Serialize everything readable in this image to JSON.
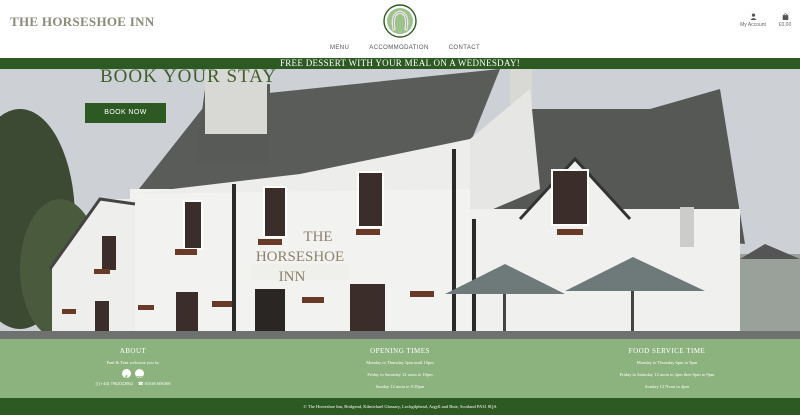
{
  "header": {
    "brand": "THE HORSESHOE INN",
    "nav": [
      "MENU",
      "ACCOMMODATION",
      "CONTACT"
    ],
    "account_label": "My Account",
    "cart_label": "£0.00"
  },
  "banner": {
    "text": "FREE DESSERT WITH YOUR MEAL ON A WEDNESDAY!"
  },
  "hero": {
    "title": "BOOK YOUR STAY",
    "button": "BOOK NOW",
    "sign_line1": "THE",
    "sign_line2": "HORSESHOE",
    "sign_line3": "INN"
  },
  "footer": {
    "about": {
      "heading": "ABOUT",
      "text": "Paul & Toni welcome you to;",
      "icons": [
        "facebook-icon",
        "tripadvisor-icon"
      ],
      "phone1": "(+44) 7962022902",
      "phone2": "01546 606369"
    },
    "opening": {
      "heading": "OPENING TIMES",
      "lines": [
        "Monday to Thursday 5pm until 10pm",
        "Friday to Saturday 12 noon to 10pm",
        "Sunday 12 noon to 9.30pm"
      ]
    },
    "food": {
      "heading": "FOOD SERVICE TIME",
      "lines": [
        "Monday to Thursday 6pm to 9pm",
        "Friday to Saturday 12 noon to 3pm then 6pm to 9pm",
        "Sunday 12 Noon to 4pm"
      ]
    },
    "copyright": "© The Horseshoe Inn, Bridgend, Kilmichael Glassary, Lochgilphead, Argyll and Bute, Scotland PA31 8QA"
  },
  "colors": {
    "brand_green": "#2d5a22",
    "footer_green": "#8cb37e",
    "brand_text": "#8a8a78"
  }
}
